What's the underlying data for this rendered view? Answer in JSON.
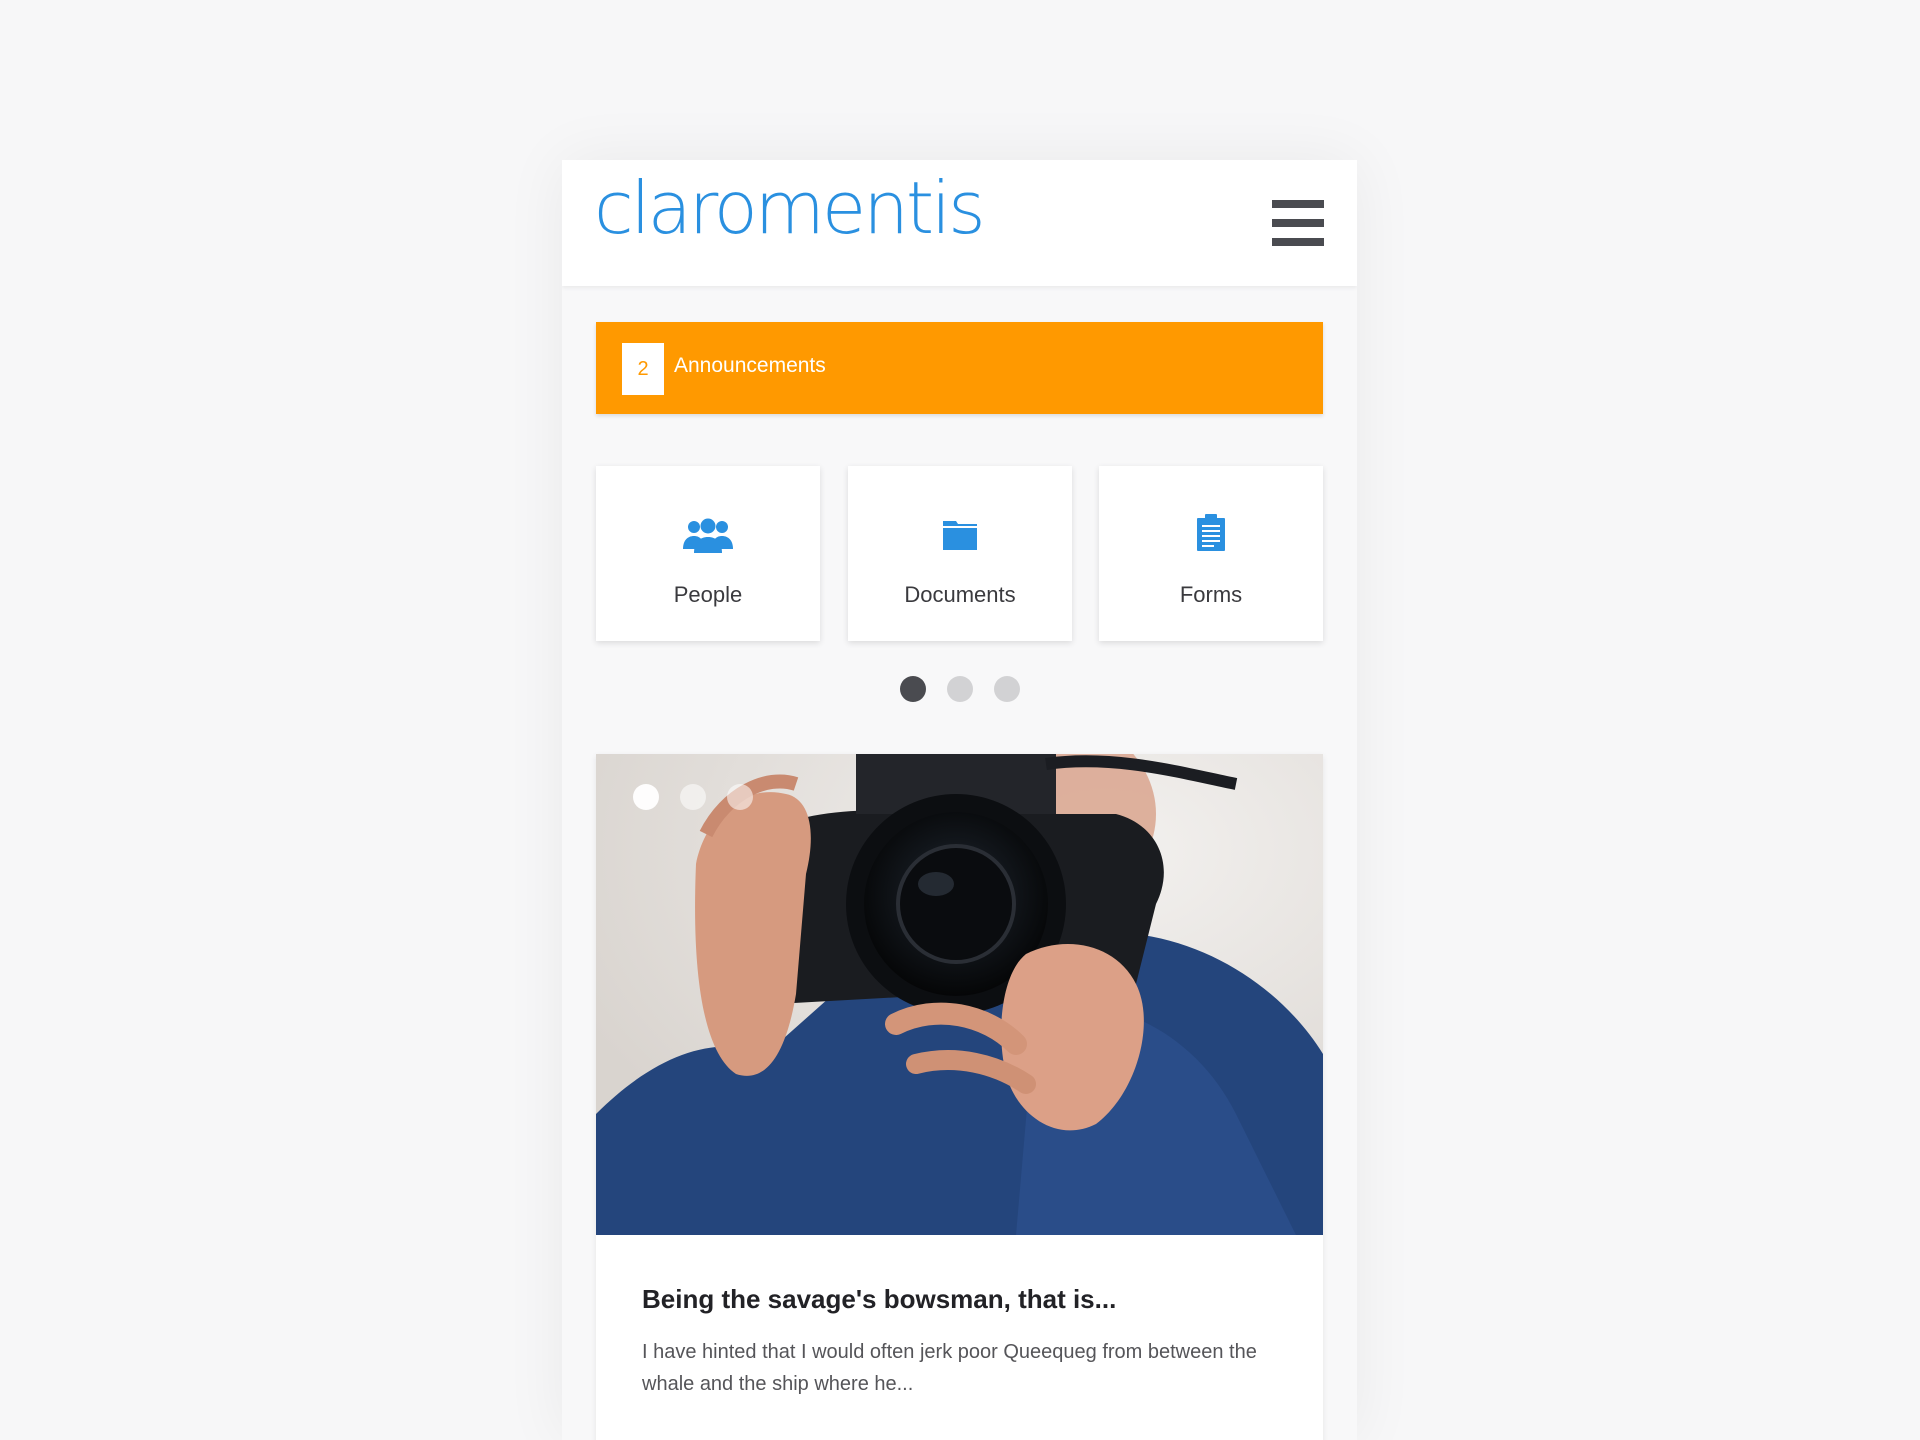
{
  "header": {
    "logo_text": "claromentis",
    "menu_icon": "hamburger-menu-icon"
  },
  "announcements": {
    "count": "2",
    "label": "Announcements",
    "color": "#ff9900"
  },
  "tiles": [
    {
      "label": "People",
      "icon": "people-group-icon"
    },
    {
      "label": "Documents",
      "icon": "folder-icon"
    },
    {
      "label": "Forms",
      "icon": "clipboard-icon"
    }
  ],
  "pagination": {
    "total": 3,
    "active_index": 0
  },
  "news_card": {
    "image": "photo of a man holding a camera",
    "image_dots": 3,
    "title": "Being the savage's bowsman, that is...",
    "excerpt": "I have hinted that I would often jerk poor Queequeg from between the whale and the ship where he..."
  },
  "colors": {
    "brand_blue": "#2a90e0",
    "accent_orange": "#ff9900",
    "dark_grey": "#4a4b50"
  }
}
